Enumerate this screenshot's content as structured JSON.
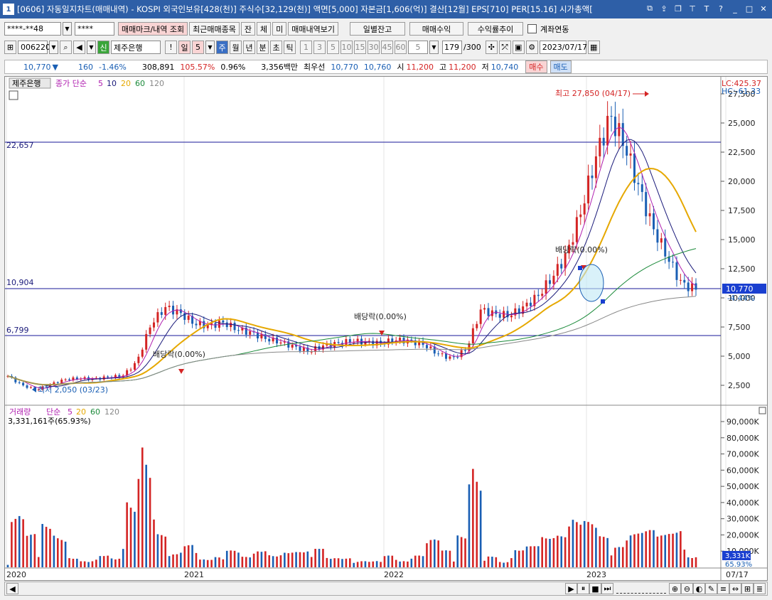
{
  "window": {
    "num": "1",
    "title": "[0606] 자동일지차트(매매내역) - KOSPI 외국인보유[428(천)] 주식수[32,129(천)] 액면[5,000] 자본금[1,606(억)] 결산[12월] EPS[710] PER[15.16] 시가총액["
  },
  "toolbar1": {
    "account": "****-**48",
    "password": "****",
    "btn_mark": "매매마크/내역 조회",
    "btn_recent": "최근매매종목",
    "btn_jan": "잔",
    "btn_che": "체",
    "btn_mi": "미",
    "btn_history": "매매내역보기",
    "btn_daily": "일별잔고",
    "btn_profit": "매매수익",
    "btn_rate": "수익률추이",
    "link_label": "계좌연동"
  },
  "toolbar2": {
    "code": "006220",
    "badge": "신",
    "name": "제주은행",
    "periods": [
      "일",
      "5",
      "주",
      "월",
      "년",
      "분",
      "초",
      "틱"
    ],
    "numbers": [
      "1",
      "3",
      "5",
      "10",
      "15",
      "30",
      "45",
      "60",
      "5"
    ],
    "count": "179",
    "count_total": "/300",
    "date": "2023/07/17"
  },
  "quote": {
    "price": "10,770",
    "change": "160",
    "change_rate": "-1.46%",
    "volume": "308,891",
    "vol_ratio": "105.57%",
    "turnover": "0.96%",
    "amount": "3,356백만",
    "best_label": "최우선",
    "ask": "10,770",
    "bid": "10,760",
    "open_label": "시",
    "open": "11,200",
    "high_label": "고",
    "high": "11,200",
    "low_label": "저",
    "low": "10,740",
    "buy": "매수",
    "sell": "매도"
  },
  "price_panel": {
    "stock_label": "제주은행",
    "legend": "종가 단순",
    "ma": [
      "5",
      "10",
      "20",
      "60",
      "120"
    ],
    "lc": "LC:425.37",
    "hc": "HC:-61.33",
    "level_high": "22,657",
    "level_mid": "10,904",
    "level_low": "6,799",
    "max_label": "최고 27,850 (04/17)",
    "min_label": "최저 2,050 (03/23)",
    "div1": "배당락(0.00%)",
    "div2": "배당락(0.00%)",
    "div3": "배당락(0.00%)",
    "current": "10,770",
    "current_pct": "-4.44%",
    "y_ticks": [
      "27,500",
      "25,000",
      "22,500",
      "20,000",
      "17,500",
      "15,000",
      "12,500",
      "10,000",
      "7,500",
      "5,000",
      "2,500"
    ]
  },
  "volume_panel": {
    "title": "거래량",
    "legend": "단순",
    "ma": [
      "5",
      "20",
      "60",
      "120"
    ],
    "summary": "3,331,161주(65.93%)",
    "current": "3,331K",
    "current_pct": "65.93%",
    "y_ticks": [
      "90,000K",
      "80,000K",
      "70,000K",
      "60,000K",
      "50,000K",
      "40,000K",
      "30,000K",
      "20,000K",
      "10,000K"
    ]
  },
  "x_axis": [
    "2020",
    "2021",
    "2022",
    "2023",
    "07/17"
  ],
  "colors": {
    "up": "#d42424",
    "down": "#1a5fb4",
    "ma5": "#b020b0",
    "ma10": "#1a1a7a",
    "ma20": "#e6a800",
    "ma60": "#1b8a3a",
    "ma120": "#888888",
    "title_bg": "#2e5fa7"
  },
  "chart_data": {
    "type": "candlestick",
    "title": "제주은행",
    "x": [
      "2020",
      "2021",
      "2022",
      "2023",
      "07/17"
    ],
    "price_series": [
      {
        "name": "종가",
        "period": "주",
        "values": [
          3300,
          2500,
          2100,
          2600,
          3000,
          3100,
          3050,
          3200,
          3300,
          4500,
          7800,
          9200,
          8700,
          7800,
          7600,
          7900,
          7300,
          7000,
          6500,
          6200,
          5800,
          5400,
          5900,
          6100,
          6300,
          6200,
          6100,
          6400,
          6300,
          6000,
          5200,
          4800,
          5600,
          9000,
          8600,
          8500,
          9200,
          10200,
          11800,
          13800,
          17500,
          22000,
          25600,
          23200,
          19500,
          16000,
          13500,
          11200,
          10770
        ]
      }
    ],
    "ma_legend": [
      "5",
      "10",
      "20",
      "60",
      "120"
    ],
    "reference_lines": [
      22657,
      10904,
      6799
    ],
    "max": {
      "value": 27850,
      "date": "04/17"
    },
    "min": {
      "value": 2050,
      "date": "03/23"
    },
    "volume_summary": "3,331,161주(65.93%)",
    "y_price_range": [
      0,
      28500
    ],
    "y_volume_range": [
      0,
      95000
    ]
  }
}
